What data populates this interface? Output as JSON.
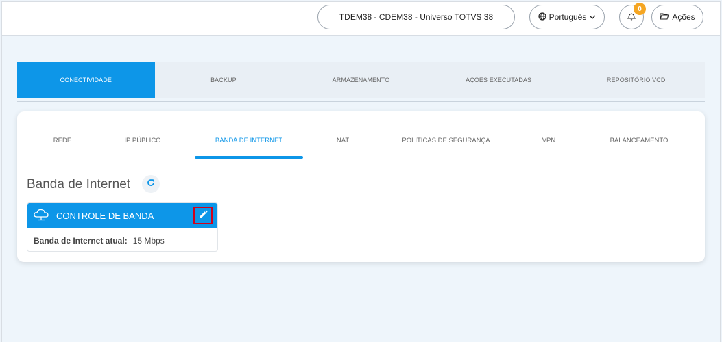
{
  "header": {
    "tenant": "TDEM38 - CDEM38 - Universo TOTVS 38",
    "language": "Português",
    "notifications_count": "0",
    "actions_label": "Ações",
    "icons": [
      "globe-icon",
      "chevron-down-icon",
      "bell-icon",
      "folder-open-icon"
    ]
  },
  "main_tabs": [
    {
      "label": "CONECTIVIDADE",
      "active": true
    },
    {
      "label": "BACKUP",
      "active": false
    },
    {
      "label": "ARMAZENAMENTO",
      "active": false
    },
    {
      "label": "AÇÕES EXECUTADAS",
      "active": false
    },
    {
      "label": "REPOSITÓRIO VCD",
      "active": false
    }
  ],
  "sub_tabs": [
    {
      "label": "REDE",
      "active": false
    },
    {
      "label": "IP PÚBLICO",
      "active": false
    },
    {
      "label": "BANDA DE INTERNET",
      "active": true
    },
    {
      "label": "NAT",
      "active": false
    },
    {
      "label": "POLÍTICAS DE SEGURANÇA",
      "active": false
    },
    {
      "label": "VPN",
      "active": false
    },
    {
      "label": "BALANCEAMENTO",
      "active": false
    }
  ],
  "section": {
    "title": "Banda de Internet",
    "refresh_icon": "refresh-icon"
  },
  "bandwidth_card": {
    "title": "CONTROLE DE BANDA",
    "icon": "cloud-network-icon",
    "edit_icon": "pencil-icon",
    "field_label": "Banda de Internet atual:",
    "field_value": "15 Mbps"
  },
  "colors": {
    "primary": "#0d96e8",
    "badge": "#f5a623",
    "highlight_border": "#d0021b"
  }
}
